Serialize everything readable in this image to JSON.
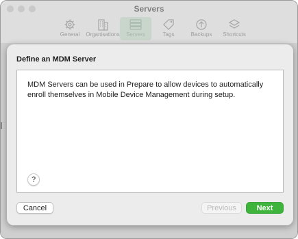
{
  "window": {
    "title": "Servers"
  },
  "toolbar": {
    "items": [
      {
        "label": "General",
        "icon": "gear-icon"
      },
      {
        "label": "Organisations",
        "icon": "building-icon"
      },
      {
        "label": "Servers",
        "icon": "servers-icon",
        "active": true
      },
      {
        "label": "Tags",
        "icon": "tag-icon"
      },
      {
        "label": "Backups",
        "icon": "backup-icon"
      },
      {
        "label": "Shortcuts",
        "icon": "shortcuts-icon"
      }
    ]
  },
  "dialog": {
    "title": "Define an MDM Server",
    "body_text": "MDM Servers can be used in Prepare to allow devices to automatically enroll themselves in Mobile Device Management during setup.",
    "help_label": "?",
    "cancel_label": "Cancel",
    "previous_label": "Previous",
    "next_label": "Next"
  },
  "colors": {
    "next_button": "#3fb43c",
    "active_tab": "#c9d6cc"
  }
}
